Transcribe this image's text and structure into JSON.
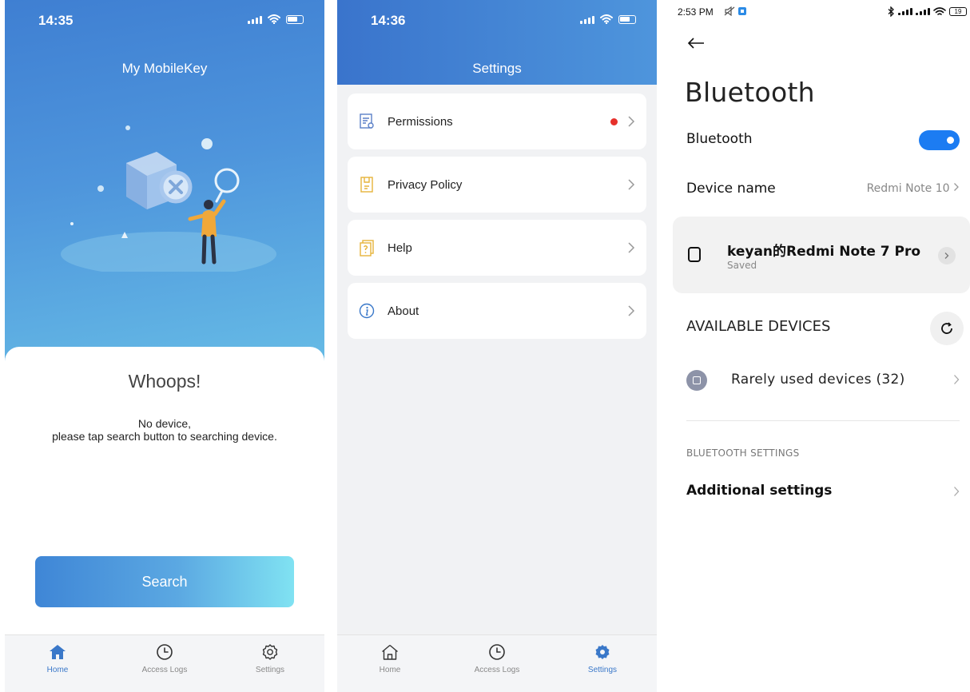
{
  "home": {
    "status_time": "14:35",
    "title": "My MobileKey",
    "heading": "Whoops!",
    "message_line1": "No device,",
    "message_line2": "please tap search button to searching device.",
    "search_label": "Search"
  },
  "tabs": {
    "home": "Home",
    "access_logs": "Access Logs",
    "settings": "Settings"
  },
  "settings": {
    "status_time": "14:36",
    "title": "Settings",
    "items": [
      {
        "label": "Permissions",
        "icon": "permissions-icon",
        "badge": true
      },
      {
        "label": "Privacy Policy",
        "icon": "privacy-policy-icon",
        "badge": false
      },
      {
        "label": "Help",
        "icon": "help-icon",
        "badge": false
      },
      {
        "label": "About",
        "icon": "about-icon",
        "badge": false
      }
    ]
  },
  "bluetooth": {
    "status_time": "2:53 PM",
    "battery": "19",
    "title": "Bluetooth",
    "toggle_label": "Bluetooth",
    "toggle_on": true,
    "device_name_label": "Device name",
    "device_name_value": "Redmi Note 10",
    "saved_device_name": "keyan的Redmi Note 7 Pro",
    "saved_device_status": "Saved",
    "available_header": "AVAILABLE DEVICES",
    "rarely_used_label": "Rarely used devices (32)",
    "settings_header": "BLUETOOTH SETTINGS",
    "additional_label": "Additional settings"
  },
  "colors": {
    "accent_blue": "#3f7fd2",
    "toggle_blue": "#1c7cf2",
    "badge_red": "#e6302b"
  }
}
